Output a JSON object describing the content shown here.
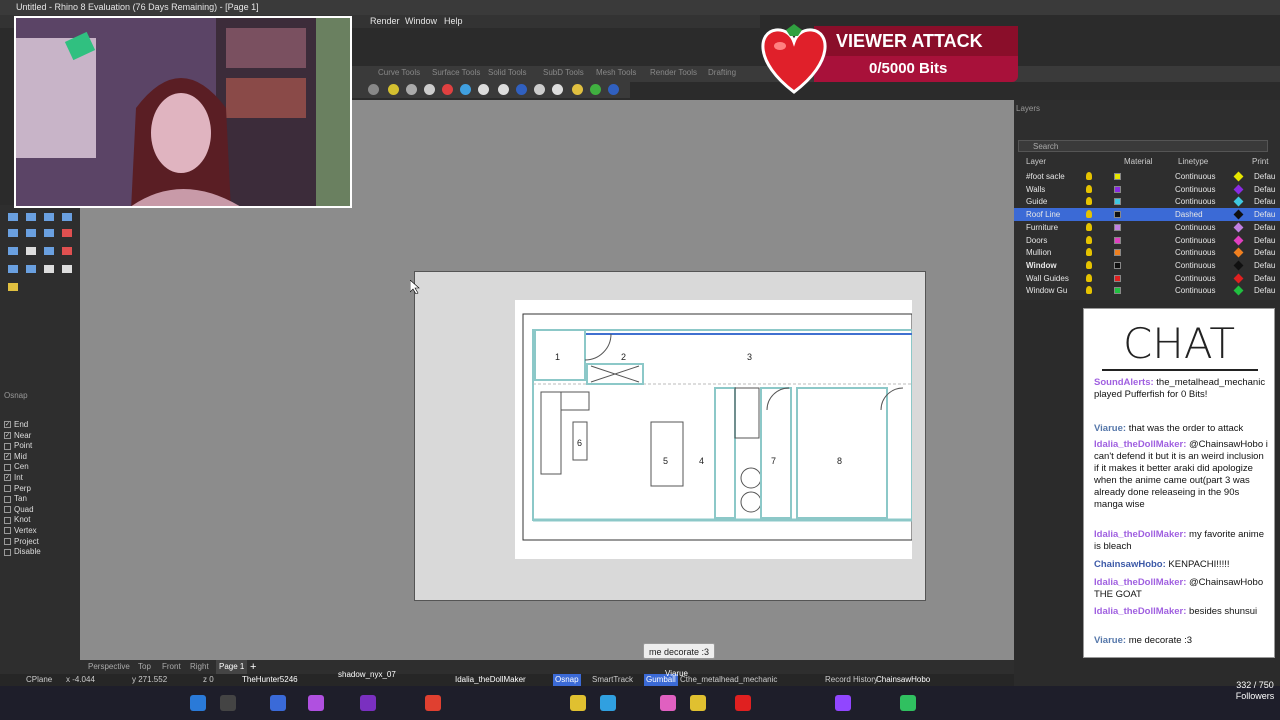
{
  "window": {
    "title": "Untitled - Rhino 8 Evaluation (76 Days Remaining) - [Page 1]"
  },
  "menu": {
    "items": [
      "Render",
      "Window",
      "Help"
    ]
  },
  "toolbar_tabs": [
    "Curve Tools",
    "Surface Tools",
    "Solid Tools",
    "SubD Tools",
    "Mesh Tools",
    "Render Tools",
    "Drafting"
  ],
  "layers": {
    "title": "Layers",
    "search_placeholder": "Search",
    "headers": {
      "layer": "Layer",
      "material": "Material",
      "linetype": "Linetype",
      "print": "Print"
    },
    "rows": [
      {
        "name": "#foot sacle",
        "color": "#e6e600",
        "linetype": "Continuous",
        "print": "Defau"
      },
      {
        "name": "Walls",
        "color": "#8a2be2",
        "linetype": "Continuous",
        "print": "Defau"
      },
      {
        "name": "Guide",
        "color": "#40c8e0",
        "linetype": "Continuous",
        "print": "Defau"
      },
      {
        "name": "Roof Line",
        "color": "#101010",
        "linetype": "Dashed",
        "print": "Defau"
      },
      {
        "name": "Furniture",
        "color": "#c080e0",
        "linetype": "Continuous",
        "print": "Defau"
      },
      {
        "name": "Doors",
        "color": "#e040c0",
        "linetype": "Continuous",
        "print": "Defau"
      },
      {
        "name": "Mullion",
        "color": "#f08020",
        "linetype": "Continuous",
        "print": "Defau"
      },
      {
        "name": "Window",
        "color": "#101010",
        "linetype": "Continuous",
        "print": "Defau"
      },
      {
        "name": "Wall Guides",
        "color": "#e02020",
        "linetype": "Continuous",
        "print": "Defau"
      },
      {
        "name": "Window Gu",
        "color": "#20c040",
        "linetype": "Continuous",
        "print": "Defau"
      }
    ]
  },
  "osnap": {
    "title": "Osnap",
    "items": [
      {
        "label": "End",
        "checked": true
      },
      {
        "label": "Near",
        "checked": true
      },
      {
        "label": "Point",
        "checked": false
      },
      {
        "label": "Mid",
        "checked": true
      },
      {
        "label": "Cen",
        "checked": false
      },
      {
        "label": "Int",
        "checked": true
      },
      {
        "label": "Perp",
        "checked": false
      },
      {
        "label": "Tan",
        "checked": false
      },
      {
        "label": "Quad",
        "checked": false
      },
      {
        "label": "Knot",
        "checked": false
      },
      {
        "label": "Vertex",
        "checked": false
      },
      {
        "label": "Project",
        "checked": false
      },
      {
        "label": "Disable",
        "checked": false
      }
    ]
  },
  "floorplan": {
    "room_labels": [
      "1",
      "2",
      "3",
      "4",
      "5",
      "6",
      "7",
      "8"
    ]
  },
  "viewer_attack": {
    "title": "VIEWER ATTACK",
    "bits": "0/5000 Bits"
  },
  "chat": {
    "title": "CHAT",
    "messages": [
      {
        "user": "SoundAlerts:",
        "text": "the_metalhead_mechanic played Pufferfish for 0 Bits!"
      },
      {
        "user": "Viarue:",
        "text": "that was the order to attack"
      },
      {
        "user": "Idalia_theDollMaker:",
        "text": "@ChainsawHobo i can't defend it but it is an weird inclusion if it makes it better araki did apologize when the anime came out(part 3 was already done releaseing in the 90s manga wise"
      },
      {
        "user": "Idalia_theDollMaker:",
        "text": "my favorite anime is bleach"
      },
      {
        "user": "ChainsawHobo:",
        "text": "KENPACHI!!!!!"
      },
      {
        "user": "Idalia_theDollMaker:",
        "text": "@ChainsawHobo THE GOAT"
      },
      {
        "user": "Idalia_theDollMaker:",
        "text": "besides shunsui"
      },
      {
        "user": "Viarue:",
        "text": "me decorate :3"
      }
    ]
  },
  "tooltip": "me decorate :3",
  "viewport_tabs": [
    "Perspective",
    "Top",
    "Front",
    "Right",
    "Page 1"
  ],
  "status": {
    "cplane": "CPlane",
    "x": "x -4.044",
    "y": "y 271.552",
    "z": "z 0",
    "osnap": "Osnap",
    "smarttrack": "SmartTrack",
    "gumball": "Gumball",
    "record_history": "Record History",
    "overlay_names": [
      "TheHunter5246",
      "shadow_nyx_07",
      "Idalia_theDollMaker",
      "Cthe_metalhead_mechanic",
      "ChainsawHobo",
      "Viarue"
    ]
  },
  "followers": {
    "count": "332 / 750",
    "label": "Followers"
  }
}
